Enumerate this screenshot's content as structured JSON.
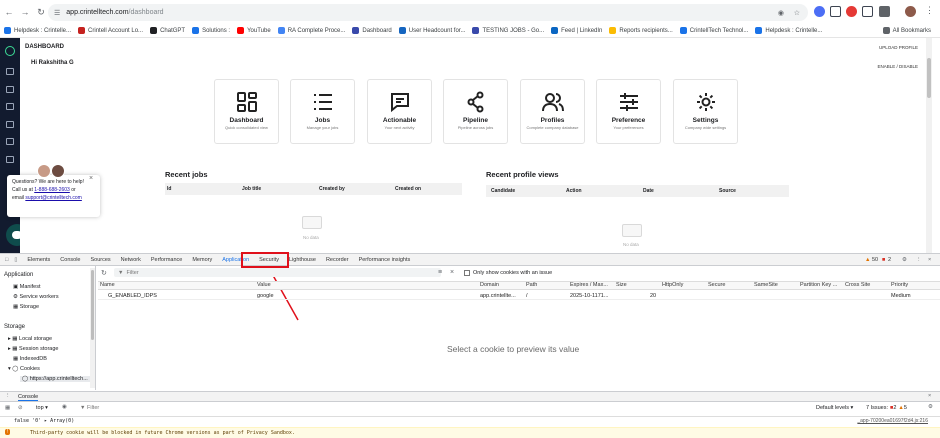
{
  "browser": {
    "url_domain": "app.crintelltech.com",
    "url_path": "/dashboard",
    "bookmarks": [
      {
        "label": "Helpdesk : Crintelle...",
        "color": "#1a73e8"
      },
      {
        "label": "Crintell Account Lo...",
        "color": "#c5221f"
      },
      {
        "label": "ChatGPT",
        "color": "#202124"
      },
      {
        "label": "Solutions :",
        "color": "#1a73e8"
      },
      {
        "label": "YouTube",
        "color": "#ff0000"
      },
      {
        "label": "RA Complete Proce...",
        "color": "#4285f4"
      },
      {
        "label": "Dashboard",
        "color": "#3949ab"
      },
      {
        "label": "User Headcount for...",
        "color": "#1565c0"
      },
      {
        "label": "TESTING JOBS - Go...",
        "color": "#3949ab"
      },
      {
        "label": "Feed | LinkedIn",
        "color": "#0a66c2"
      },
      {
        "label": "Reports recipients...",
        "color": "#fbbc04"
      },
      {
        "label": "CrintellTech Technol...",
        "color": "#1a73e8"
      },
      {
        "label": "Helpdesk : Crintelle...",
        "color": "#1a73e8"
      }
    ],
    "all_bookmarks": "All Bookmarks"
  },
  "page": {
    "title": "DASHBOARD",
    "upload_profile": "UPLOAD PROFILE",
    "greeting": "Hi Rakshitha G",
    "enable_disable": "ENABLE / DISABLE",
    "cards": [
      {
        "title": "Dashboard",
        "subtitle": "Quick consolidated view"
      },
      {
        "title": "Jobs",
        "subtitle": "Manage your jobs"
      },
      {
        "title": "Actionable",
        "subtitle": "Your next activity"
      },
      {
        "title": "Pipeline",
        "subtitle": "Pipeline across jobs"
      },
      {
        "title": "Profiles",
        "subtitle": "Complete company database"
      },
      {
        "title": "Preference",
        "subtitle": "Your preferences"
      },
      {
        "title": "Settings",
        "subtitle": "Company wide settings"
      }
    ],
    "recent_jobs": {
      "title": "Recent jobs",
      "columns": [
        "Id",
        "Job title",
        "Created by",
        "Created on"
      ],
      "empty": "No data"
    },
    "recent_profiles": {
      "title": "Recent profile views",
      "columns": [
        "Candidate",
        "Action",
        "Date",
        "Source"
      ],
      "empty": "No data"
    },
    "help": {
      "line1": "Questions? We are here to help!",
      "call_prefix": "Call us at",
      "phone": "1-888-688-2603",
      "call_suffix": "or",
      "email_prefix": "email",
      "email": "support@crintelltech.com"
    }
  },
  "devtools": {
    "tabs": [
      "Elements",
      "Console",
      "Sources",
      "Network",
      "Performance",
      "Memory",
      "Application",
      "Security",
      "Lighthouse",
      "Recorder",
      "Performance insights"
    ],
    "active_tab": "Application",
    "warnings": "50",
    "errors": "2",
    "filter_placeholder": "Filter",
    "only_cookies_issue": "Only show cookies with an issue",
    "app_section": "Application",
    "app_items": [
      "Manifest",
      "Service workers",
      "Storage"
    ],
    "storage_section": "Storage",
    "storage_items": [
      "Local storage",
      "Session storage",
      "IndexedDB",
      "Cookies"
    ],
    "cookie_site": "https://app.crintelltech...",
    "columns": [
      "Name",
      "Value",
      "Domain",
      "Path",
      "Expires / Max...",
      "Size",
      "HttpOnly",
      "Secure",
      "SameSite",
      "Partition Key ...",
      "Cross Site",
      "Priority"
    ],
    "row": {
      "name": "G_ENABLED_IDPS",
      "value": "google",
      "domain": "app.crintellte...",
      "path": "/",
      "expires": "2025-10-1171...",
      "size": "20",
      "priority": "Medium"
    },
    "preview_msg": "Select a cookie to preview its value",
    "console_tab": "Console",
    "context": "top",
    "console_filter": "Filter",
    "levels": "Default levels",
    "issues_label": "7 Issues:",
    "issues_err": "2",
    "issues_warn": "5",
    "log_false": "false  '0'  ▸ Array(0)",
    "log_src": "_app-70200ea01697f2d4.js:216",
    "log_warn": "Third-party cookie will be blocked in future Chrome versions as part of Privacy Sandbox."
  }
}
